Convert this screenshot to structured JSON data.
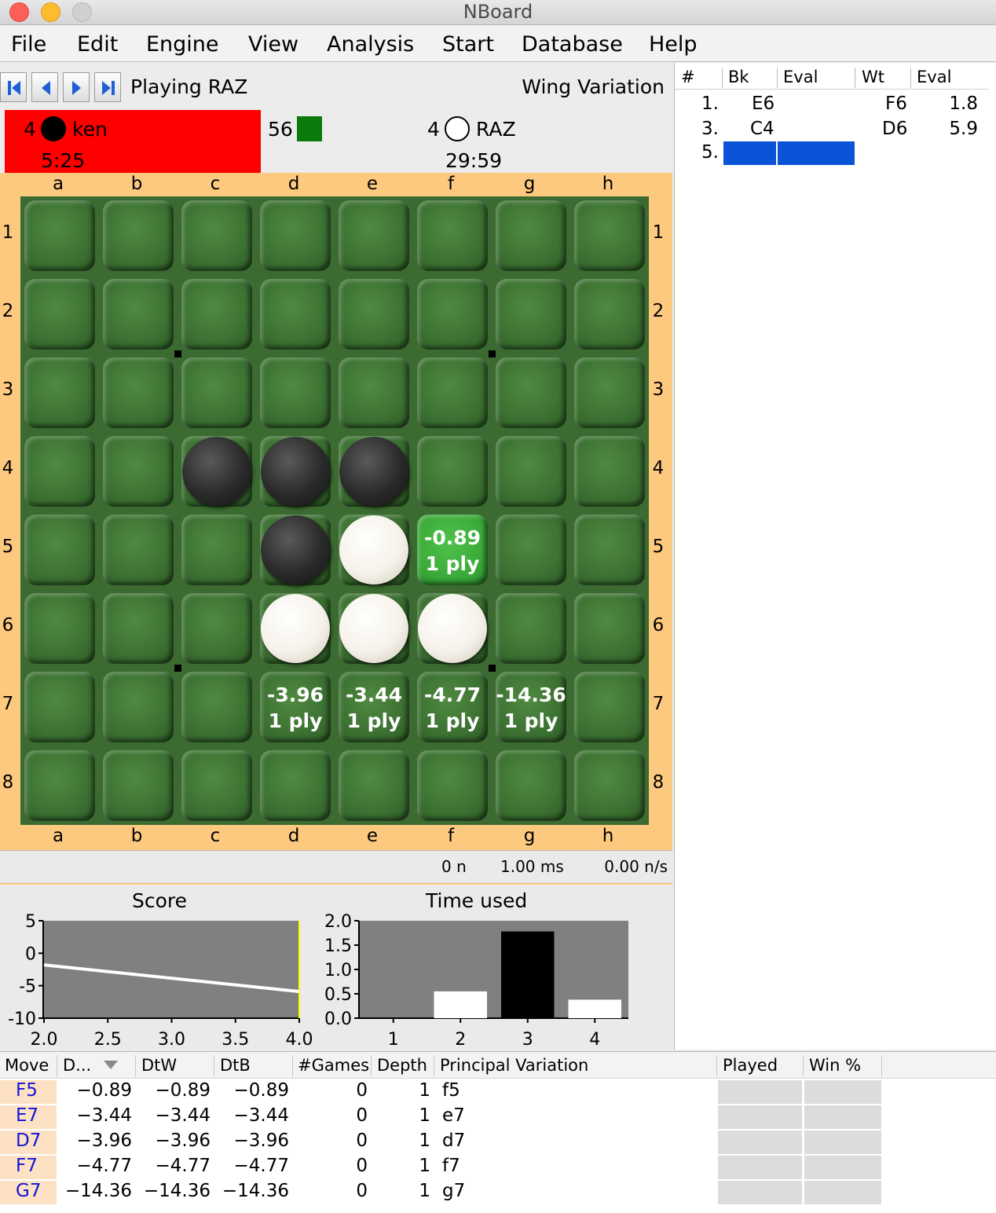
{
  "window": {
    "title": "NBoard"
  },
  "menu": [
    "File",
    "Edit",
    "Engine",
    "View",
    "Analysis",
    "Start",
    "Database",
    "Help"
  ],
  "status": {
    "playing": "Playing RAZ",
    "opening": "Wing Variation"
  },
  "players": {
    "black": {
      "count": "4",
      "name": "ken",
      "time": "5:25",
      "highlight_color": "#ff0000"
    },
    "empty": {
      "count": "56"
    },
    "white": {
      "count": "4",
      "name": "RAZ",
      "time": "29:59"
    }
  },
  "board": {
    "columns": [
      "a",
      "b",
      "c",
      "d",
      "e",
      "f",
      "g",
      "h"
    ],
    "rows": [
      "1",
      "2",
      "3",
      "4",
      "5",
      "6",
      "7",
      "8"
    ],
    "discs": [
      {
        "square": "c4",
        "color": "black"
      },
      {
        "square": "d4",
        "color": "black"
      },
      {
        "square": "e4",
        "color": "black"
      },
      {
        "square": "d5",
        "color": "black"
      },
      {
        "square": "e5",
        "color": "white"
      },
      {
        "square": "d6",
        "color": "white"
      },
      {
        "square": "e6",
        "color": "white"
      },
      {
        "square": "f6",
        "color": "white"
      }
    ],
    "evals": [
      {
        "square": "f5",
        "score": "-0.89",
        "depth": "1 ply",
        "best": true
      },
      {
        "square": "d7",
        "score": "-3.96",
        "depth": "1 ply"
      },
      {
        "square": "e7",
        "score": "-3.44",
        "depth": "1 ply"
      },
      {
        "square": "f7",
        "score": "-4.77",
        "depth": "1 ply"
      },
      {
        "square": "g7",
        "score": "-14.36",
        "depth": "1 ply"
      }
    ]
  },
  "engine_status": {
    "nodes": "0 n",
    "time": "1.00 ms",
    "speed": "0.00 n/s"
  },
  "movelist": {
    "headers": [
      "#",
      "Bk",
      "Eval",
      "Wt",
      "Eval"
    ],
    "rows": [
      {
        "num": "1.",
        "bk": "E6",
        "bk_eval": "",
        "wt": "F6",
        "wt_eval": "1.8"
      },
      {
        "num": "3.",
        "bk": "C4",
        "bk_eval": "",
        "wt": "D6",
        "wt_eval": "5.9"
      },
      {
        "num": "5.",
        "bk": "",
        "bk_eval": "",
        "wt": "",
        "wt_eval": ""
      }
    ]
  },
  "chart_data": [
    {
      "type": "line",
      "title": "Score",
      "x": [
        2.0,
        4.0
      ],
      "series": [
        {
          "values": [
            -1.8,
            -5.9
          ]
        }
      ],
      "xlim": [
        2.0,
        4.0
      ],
      "ylim": [
        -10,
        5
      ],
      "xticks": [
        "2.0",
        "2.5",
        "3.0",
        "3.5",
        "4.0"
      ],
      "yticks": [
        "5",
        "0",
        "-5",
        "-10"
      ]
    },
    {
      "type": "bar",
      "title": "Time used",
      "categories": [
        "1",
        "2",
        "3",
        "4"
      ],
      "values": [
        0.0,
        0.55,
        1.78,
        0.38
      ],
      "bar_colors": [
        "#ffffff",
        "#ffffff",
        "#000000",
        "#ffffff"
      ],
      "ylim": [
        0.0,
        2.0
      ],
      "yticks": [
        "2.0",
        "1.5",
        "1.0",
        "0.5",
        "0.0"
      ]
    }
  ],
  "analysis": {
    "headers": [
      "Move",
      "D...",
      "DtW",
      "DtB",
      "#Games",
      "Depth",
      "Principal Variation",
      "Played",
      "Win %"
    ],
    "rows": [
      {
        "move": "F5",
        "d": "−0.89",
        "dtw": "−0.89",
        "dtb": "−0.89",
        "games": "0",
        "depth": "1",
        "pv": "f5"
      },
      {
        "move": "E7",
        "d": "−3.44",
        "dtw": "−3.44",
        "dtb": "−3.44",
        "games": "0",
        "depth": "1",
        "pv": "e7"
      },
      {
        "move": "D7",
        "d": "−3.96",
        "dtw": "−3.96",
        "dtb": "−3.96",
        "games": "0",
        "depth": "1",
        "pv": "d7"
      },
      {
        "move": "F7",
        "d": "−4.77",
        "dtw": "−4.77",
        "dtb": "−4.77",
        "games": "0",
        "depth": "1",
        "pv": "f7"
      },
      {
        "move": "G7",
        "d": "−14.36",
        "dtw": "−14.36",
        "dtb": "−14.36",
        "games": "0",
        "depth": "1",
        "pv": "g7"
      }
    ]
  }
}
